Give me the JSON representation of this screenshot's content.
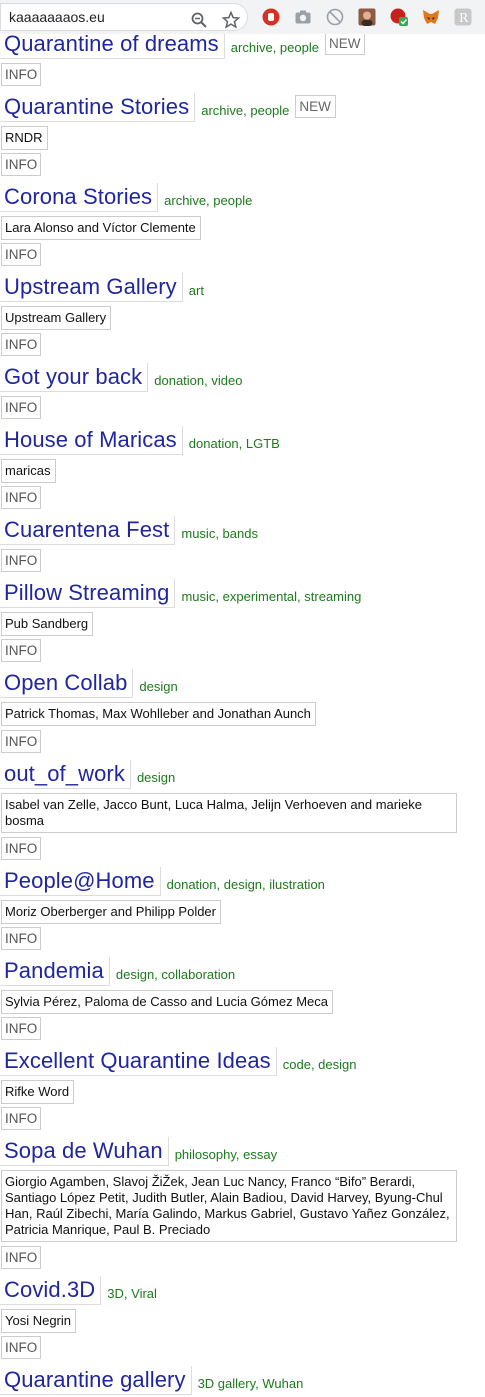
{
  "browser": {
    "url": "kaaaaaaaos.eu",
    "toolbar_icons": [
      "zoom-icon",
      "bookmark-star-icon",
      "stop-hand-extension-icon",
      "camera-extension-icon",
      "ad-blocker-extension-icon",
      "profile-extension-icon",
      "wappalyzer-extension-icon",
      "metamask-fox-icon",
      "reader-extension-icon"
    ]
  },
  "colors": {
    "title": "#2026a0",
    "tags": "#1d7a1d",
    "border": "#cccccc"
  },
  "entries": [
    {
      "title": "Quarantine of dreams",
      "tags": "archive, people",
      "badge": "NEW",
      "info": "INFO"
    },
    {
      "title": "Quarantine Stories",
      "tags": "archive, people",
      "badge": "NEW",
      "authors": "RNDR",
      "info": "INFO"
    },
    {
      "title": "Corona Stories",
      "tags": "archive, people",
      "authors": "Lara Alonso and Víctor Clemente",
      "info": "INFO"
    },
    {
      "title": "Upstream Gallery",
      "tags": "art",
      "authors": "Upstream Gallery",
      "info": "INFO"
    },
    {
      "title": "Got your back",
      "tags": "donation, video",
      "info": "INFO"
    },
    {
      "title": "House of Maricas",
      "tags": "donation, LGTB",
      "authors": "maricas",
      "info": "INFO"
    },
    {
      "title": "Cuarentena Fest",
      "tags": "music, bands",
      "info": "INFO"
    },
    {
      "title": "Pillow Streaming",
      "tags": "music, experimental, streaming",
      "authors": "Pub Sandberg",
      "info": "INFO"
    },
    {
      "title": "Open Collab",
      "tags": "design",
      "authors": "Patrick Thomas, Max Wohlleber and Jonathan Aunch",
      "info": "INFO"
    },
    {
      "title": "out_of_work",
      "tags": "design",
      "authors": "Isabel van Zelle, Jacco Bunt, Luca Halma, Jelijn Verhoeven and marieke bosma",
      "info": "INFO"
    },
    {
      "title": "People@Home",
      "tags": "donation, design, ilustration",
      "authors": "Moriz Oberberger and Philipp Polder",
      "info": "INFO"
    },
    {
      "title": "Pandemia",
      "tags": "design, collaboration",
      "authors": "Sylvia Pérez, Paloma de Casso and Lucia Gómez Meca",
      "info": "INFO"
    },
    {
      "title": "Excellent Quarantine Ideas",
      "tags": "code, design",
      "authors": "Rifke Word",
      "info": "INFO"
    },
    {
      "title": "Sopa de Wuhan",
      "tags": "philosophy, essay",
      "authors": "Giorgio Agamben, Slavoj ŽiŽek, Jean Luc Nancy, Franco “Bifo” Berardi, Santiago López Petit, Judith Butler, Alain Badiou, David Harvey, Byung-Chul Han, Raúl Zibechi, María Galindo, Markus Gabriel, Gustavo Yañez González, Patricia Manrique, Paul B. Preciado",
      "info": "INFO"
    },
    {
      "title": "Covid.3D",
      "tags": "3D, Viral",
      "authors": "Yosi Negrin",
      "info": "INFO"
    },
    {
      "title": "Quarantine gallery",
      "tags": "3D gallery, Wuhan"
    }
  ]
}
